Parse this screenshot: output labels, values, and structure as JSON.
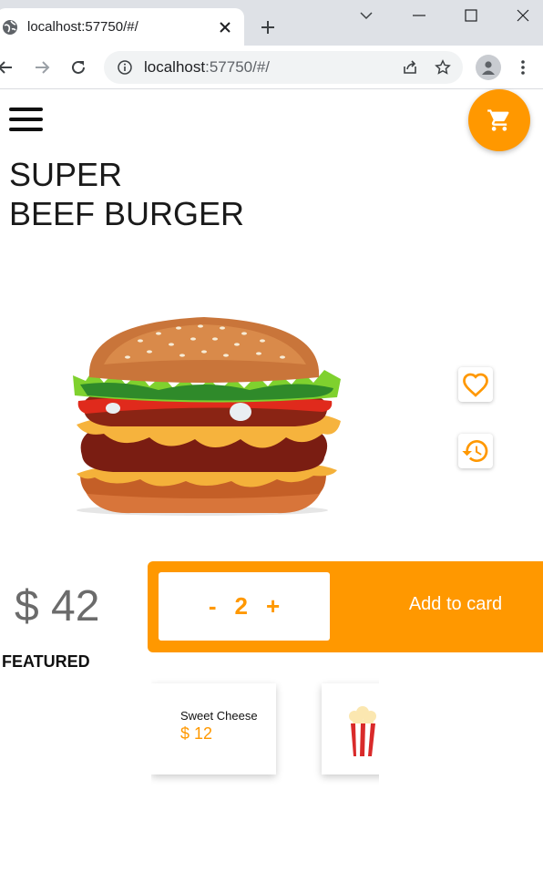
{
  "browser": {
    "tab_title": "localhost:57750/#/",
    "url_host": "localhost",
    "url_rest": ":57750/#/"
  },
  "product": {
    "title_line1": "SUPER",
    "title_line2": "BEEF BURGER",
    "price": "$ 42",
    "quantity": "2",
    "minus": "-",
    "plus": "+",
    "add_label": "Add to card"
  },
  "featured": {
    "heading": "FEATURED",
    "items": [
      {
        "name": "Sweet Cheese",
        "price": "$ 12"
      },
      {
        "name": "",
        "price": ""
      }
    ]
  },
  "colors": {
    "accent": "#ff9800"
  },
  "icons": [
    "globe-icon",
    "close-icon",
    "plus-icon",
    "chevron-down-icon",
    "minimize-icon",
    "maximize-icon",
    "back-icon",
    "forward-icon",
    "reload-icon",
    "info-icon",
    "share-icon",
    "star-icon",
    "profile-icon",
    "kebab-menu-icon",
    "hamburger-icon",
    "cart-icon",
    "heart-icon",
    "history-icon"
  ]
}
